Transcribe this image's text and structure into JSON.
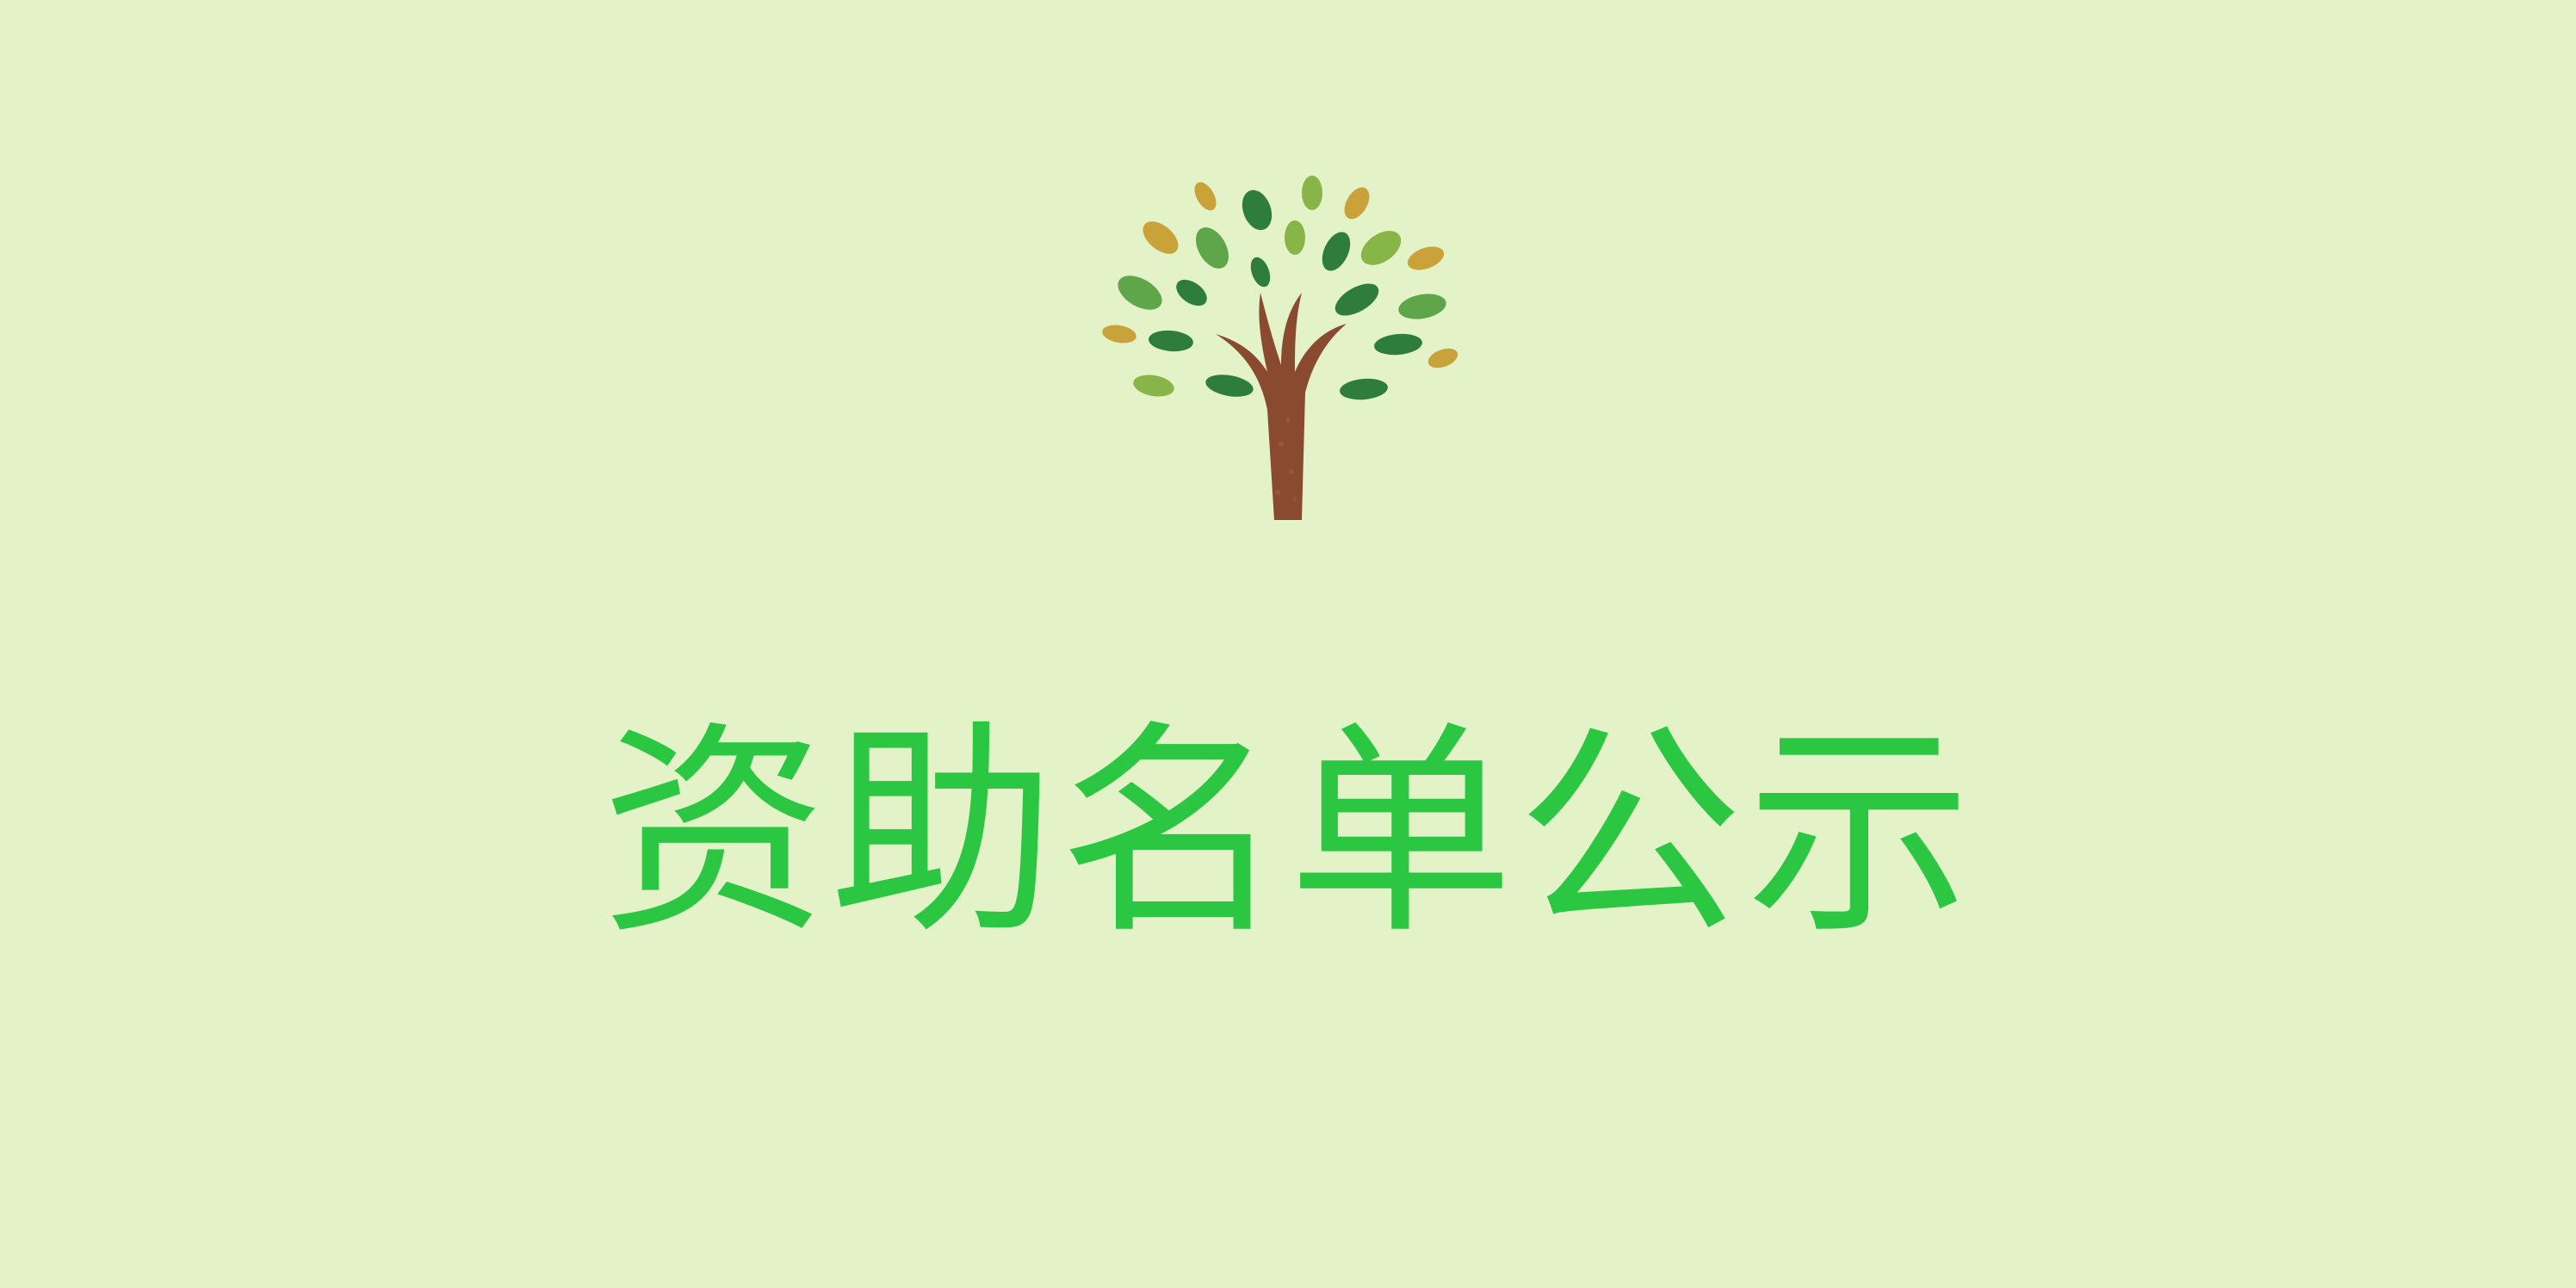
{
  "page": {
    "title": "资助名单公示",
    "background": "#e3f2c7",
    "title_color": "#2cc742"
  },
  "logo": {
    "icon": "tree-icon",
    "trunk_color": "#8a4a30",
    "leaf_colors": [
      "#2f7d3c",
      "#5fa64a",
      "#88b548",
      "#c9a23a"
    ]
  }
}
